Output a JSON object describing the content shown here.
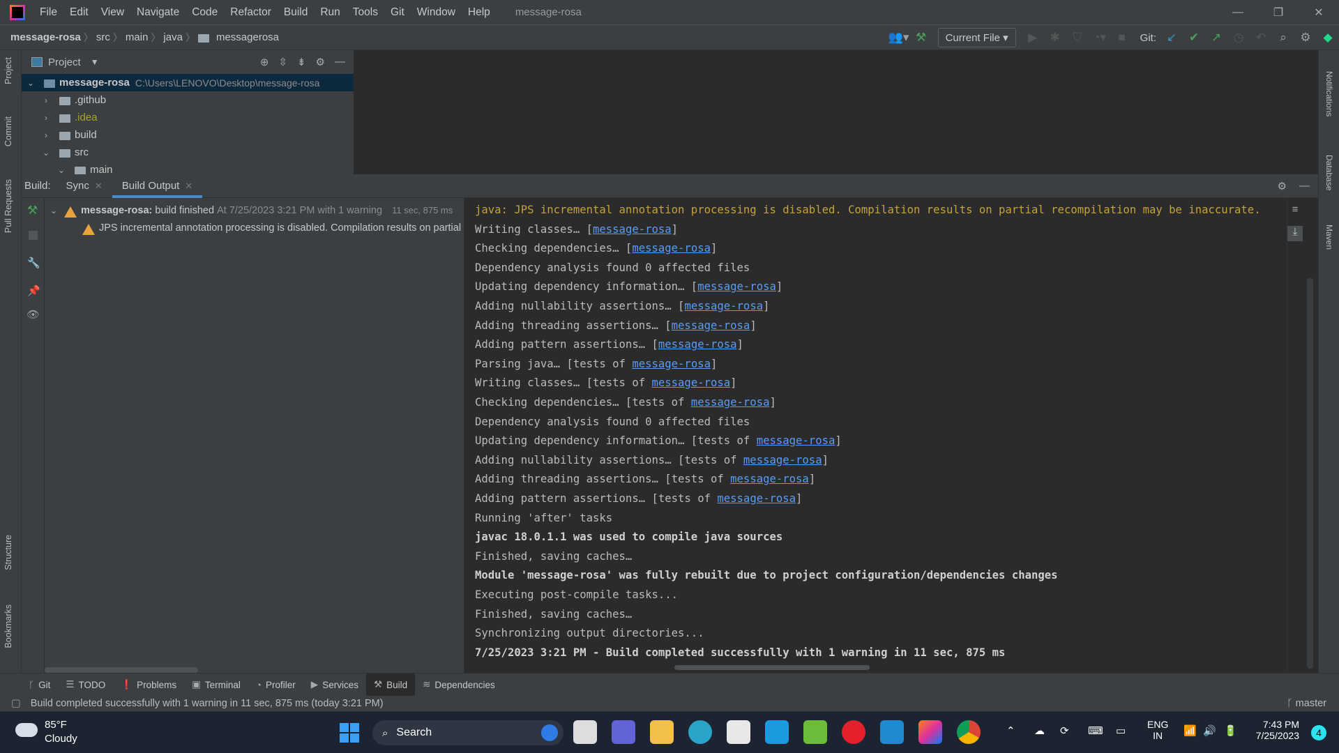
{
  "window": {
    "title": "message-rosa"
  },
  "menu": [
    "File",
    "Edit",
    "View",
    "Navigate",
    "Code",
    "Refactor",
    "Build",
    "Run",
    "Tools",
    "Git",
    "Window",
    "Help"
  ],
  "breadcrumb": [
    "message-rosa",
    "src",
    "main",
    "java",
    "messagerosa"
  ],
  "toolbar": {
    "run_config": "Current File",
    "git_label": "Git:"
  },
  "project_panel": {
    "title": "Project",
    "root_name": "message-rosa",
    "root_path": "C:\\Users\\LENOVO\\Desktop\\message-rosa",
    "items": [
      ".github",
      ".idea",
      "build",
      "src",
      "main"
    ]
  },
  "left_stripe": [
    "Project",
    "Commit",
    "Pull Requests",
    "Structure",
    "Bookmarks"
  ],
  "right_stripe": [
    "Notifications",
    "Database",
    "Maven"
  ],
  "build": {
    "label": "Build:",
    "tabs": [
      "Sync",
      "Build Output"
    ],
    "tree": {
      "project": "message-rosa:",
      "status": "build finished",
      "when": "At 7/25/2023 3:21 PM with 1 warning",
      "duration": "11 sec, 875 ms",
      "warning": "JPS incremental annotation processing is disabled. Compilation results on partial recompilation may be inaccurate."
    },
    "console": [
      {
        "text": "java: JPS incremental annotation processing is disabled. Compilation results on partial recompilation may be inaccurate.",
        "style": "warn"
      },
      {
        "text": "Writing classes… [",
        "link": "message-rosa",
        "after": "]"
      },
      {
        "text": "Checking dependencies… [",
        "link": "message-rosa",
        "after": "]"
      },
      {
        "text": "Dependency analysis found 0 affected files"
      },
      {
        "text": "Updating dependency information… [",
        "link": "message-rosa",
        "after": "]"
      },
      {
        "text": "Adding nullability assertions… [",
        "link": "message-rosa",
        "after": "]"
      },
      {
        "text": "Adding threading assertions… [",
        "link": "message-rosa",
        "after": "]"
      },
      {
        "text": "Adding pattern assertions… [",
        "link": "message-rosa",
        "after": "]"
      },
      {
        "text": "Parsing java… [tests of ",
        "link": "message-rosa",
        "after": "]"
      },
      {
        "text": "Writing classes… [tests of ",
        "link": "message-rosa",
        "after": "]"
      },
      {
        "text": "Checking dependencies… [tests of ",
        "link": "message-rosa",
        "after": "]"
      },
      {
        "text": "Dependency analysis found 0 affected files"
      },
      {
        "text": "Updating dependency information… [tests of ",
        "link": "message-rosa",
        "after": "]"
      },
      {
        "text": "Adding nullability assertions… [tests of ",
        "link": "message-rosa",
        "after": "]"
      },
      {
        "text": "Adding threading assertions… [tests of ",
        "link": "message-rosa",
        "after": "]"
      },
      {
        "text": "Adding pattern assertions… [tests of ",
        "link": "message-rosa",
        "after": "]"
      },
      {
        "text": "Running 'after' tasks"
      },
      {
        "text": "javac 18.0.1.1 was used to compile java sources",
        "style": "bold"
      },
      {
        "text": "Finished, saving caches…"
      },
      {
        "text": "Module 'message-rosa' was fully rebuilt due to project configuration/dependencies changes",
        "style": "bold"
      },
      {
        "text": "Executing post-compile tasks..."
      },
      {
        "text": "Finished, saving caches…"
      },
      {
        "text": "Synchronizing output directories..."
      },
      {
        "text": "7/25/2023 3:21 PM - Build completed successfully with 1 warning in 11 sec, 875 ms",
        "style": "bold"
      }
    ]
  },
  "bottom_tabs": [
    "Git",
    "TODO",
    "Problems",
    "Terminal",
    "Profiler",
    "Services",
    "Build",
    "Dependencies"
  ],
  "status": {
    "message": "Build completed successfully with 1 warning in 11 sec, 875 ms (today 3:21 PM)",
    "branch": "master"
  },
  "taskbar": {
    "temp": "85°F",
    "weather": "Cloudy",
    "search": "Search",
    "lang1": "ENG",
    "lang2": "IN",
    "time": "7:43 PM",
    "date": "7/25/2023",
    "notif_count": "4"
  }
}
